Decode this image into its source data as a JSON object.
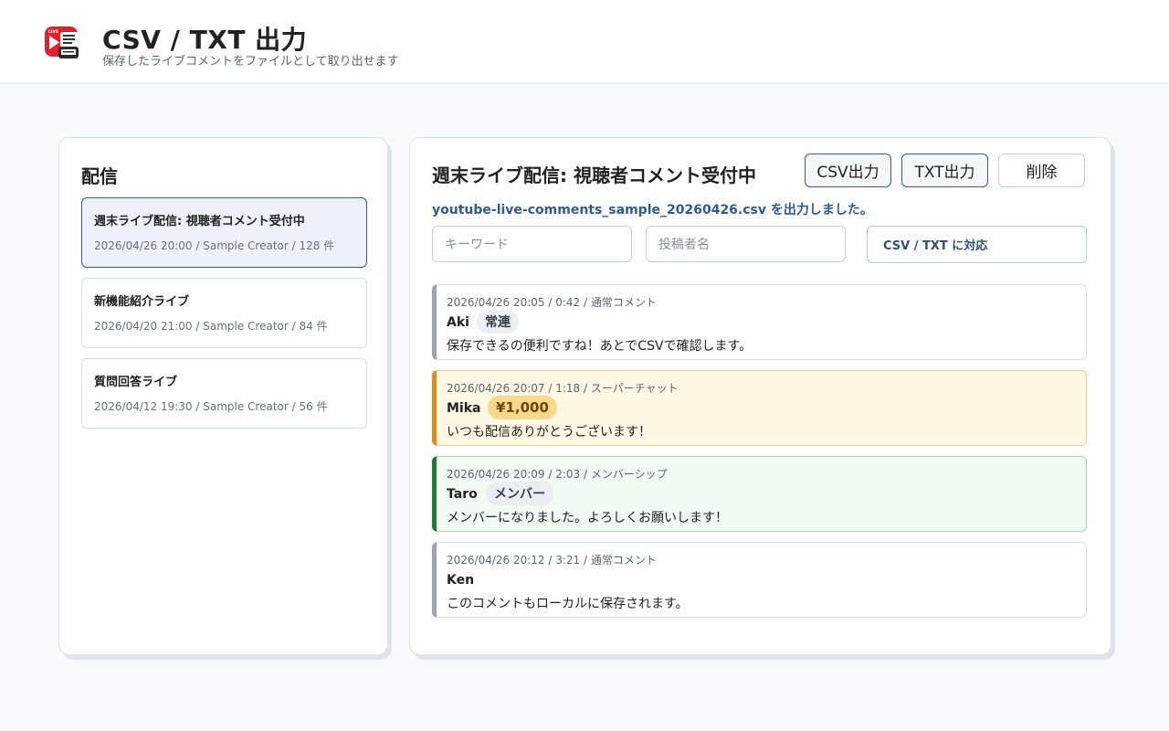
{
  "header": {
    "title": "CSV / TXT 出力",
    "subtitle": "保存したライブコメントをファイルとして取り出せます",
    "logo_text": "LIVE"
  },
  "sidebar": {
    "title": "配信",
    "items": [
      {
        "name": "週末ライブ配信: 視聴者コメント受付中",
        "meta": "2026/04/26 20:00 / Sample Creator / 128 件",
        "selected": true
      },
      {
        "name": "新機能紹介ライブ",
        "meta": "2026/04/20 21:00 / Sample Creator / 84 件",
        "selected": false
      },
      {
        "name": "質問回答ライブ",
        "meta": "2026/04/12 19:30 / Sample Creator / 56 件",
        "selected": false
      }
    ]
  },
  "detail": {
    "title": "週末ライブ配信: 視聴者コメント受付中",
    "csv_button": "CSV出力",
    "txt_button": "TXT出力",
    "delete_button": "削除",
    "status": "youtube-live-comments_sample_20260426.csv を出力しました。",
    "keyword_placeholder": "キーワード",
    "author_placeholder": "投稿者名",
    "format_label": "CSV / TXT に対応"
  },
  "comments": [
    {
      "meta": "2026/04/26 20:05 / 0:42 / 通常コメント",
      "author": "Aki",
      "badge": "常連",
      "text": "保存できるの便利ですね！あとでCSVで確認します。",
      "type": "normal"
    },
    {
      "meta": "2026/04/26 20:07 / 1:18 / スーパーチャット",
      "author": "Mika",
      "badge": "¥1,000",
      "text": "いつも配信ありがとうございます！",
      "type": "superchat"
    },
    {
      "meta": "2026/04/26 20:09 / 2:03 / メンバーシップ",
      "author": "Taro",
      "badge": "メンバー",
      "text": "メンバーになりました。よろしくお願いします！",
      "type": "member"
    },
    {
      "meta": "2026/04/26 20:12 / 3:21 / 通常コメント",
      "author": "Ken",
      "badge": "",
      "text": "このコメントもローカルに保存されます。",
      "type": "normal"
    }
  ],
  "colors": {
    "accent": "#2f5a95",
    "logo_red": "#e0202a",
    "superchat_border": "#df8a1c",
    "member_border": "#1d7d35",
    "normal_border": "#9aa4b2"
  }
}
